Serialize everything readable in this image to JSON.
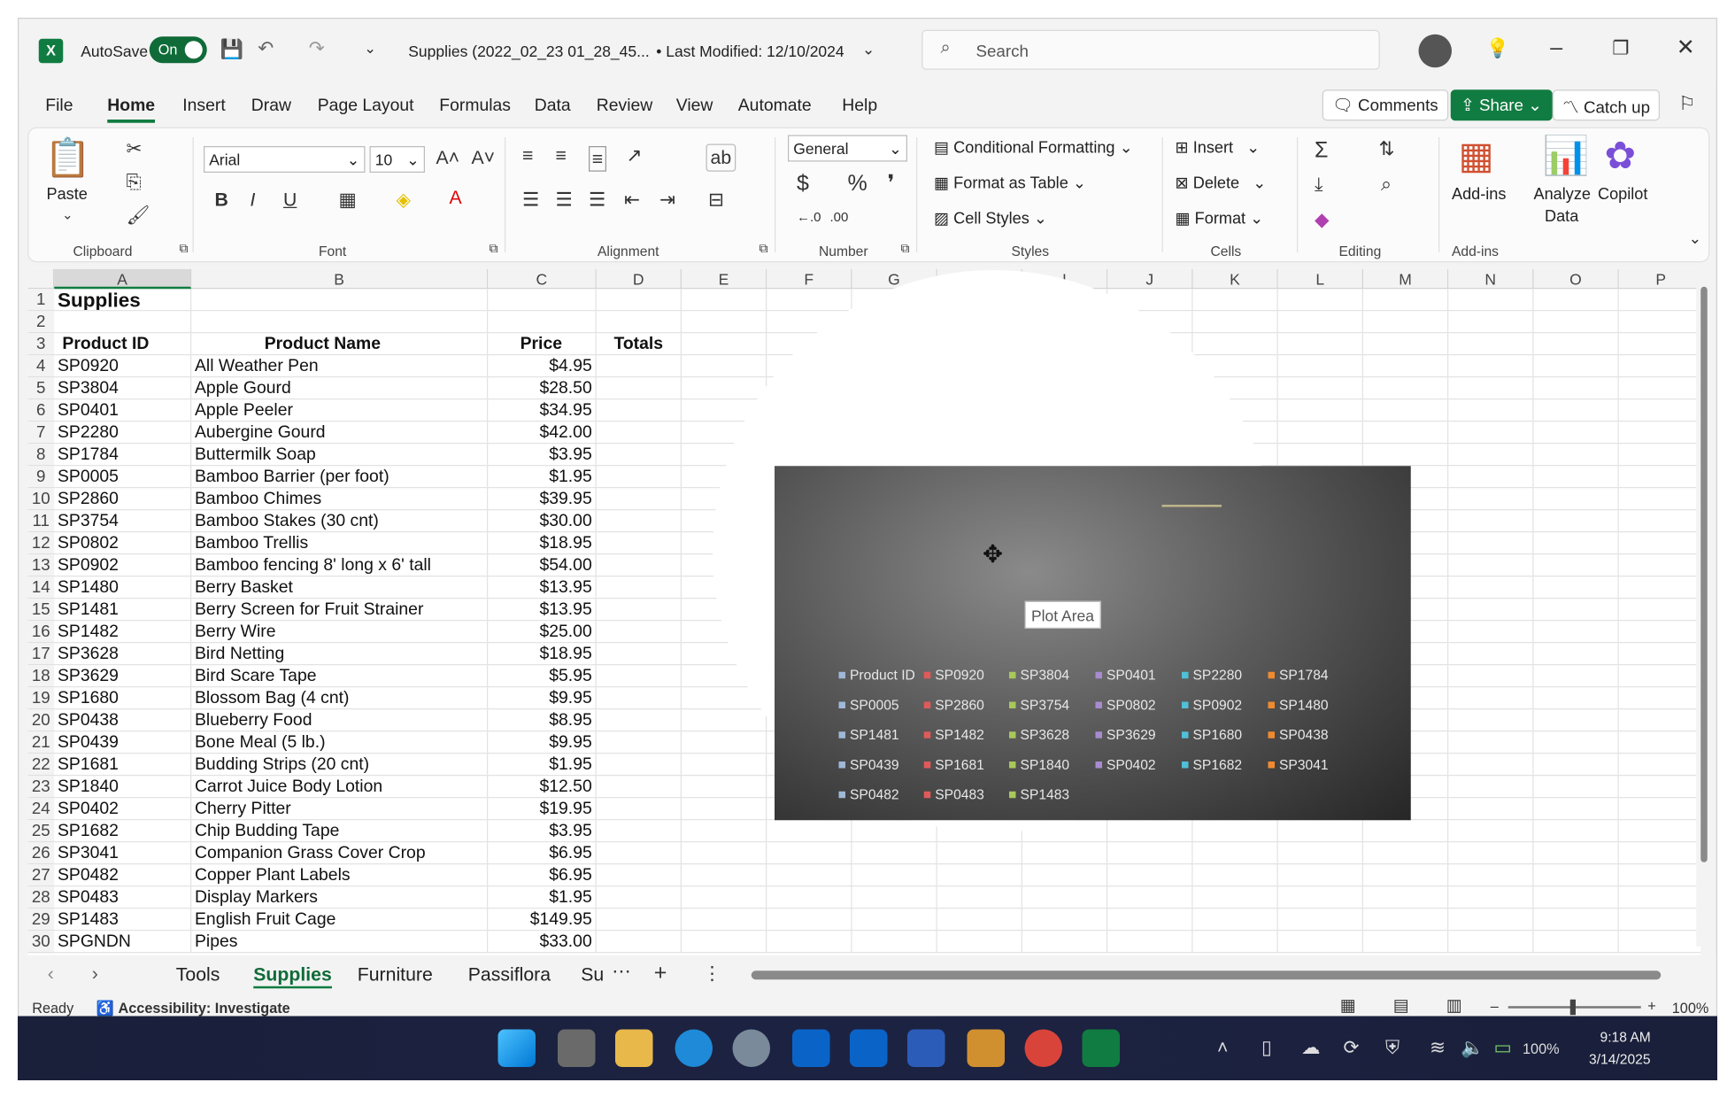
{
  "titlebar": {
    "autosave_label": "AutoSave",
    "autosave_state": "On",
    "filename": "Supplies (2022_02_23 01_28_45...",
    "modified": "• Last Modified: 12/10/2024",
    "search_placeholder": "Search"
  },
  "menu": [
    "File",
    "Home",
    "Insert",
    "Draw",
    "Page Layout",
    "Formulas",
    "Data",
    "Review",
    "View",
    "Automate",
    "Help"
  ],
  "menu_active": "Home",
  "actions": {
    "comments": "Comments",
    "share": "Share",
    "catchup": "Catch up"
  },
  "ribbon": {
    "paste": "Paste",
    "font_name": "Arial",
    "font_size": "10",
    "number_format": "General",
    "conditional_formatting": "Conditional Formatting",
    "format_as_table": "Format as Table",
    "cell_styles": "Cell Styles",
    "insert": "Insert",
    "delete": "Delete",
    "format": "Format",
    "addins": "Add-ins",
    "analyze1": "Analyze",
    "analyze2": "Data",
    "copilot": "Copilot",
    "groups": {
      "clipboard": "Clipboard",
      "font": "Font",
      "alignment": "Alignment",
      "number": "Number",
      "styles": "Styles",
      "cells": "Cells",
      "editing": "Editing",
      "addins": "Add-ins"
    }
  },
  "columns": [
    "A",
    "B",
    "C",
    "D",
    "E",
    "F",
    "G",
    "H",
    "I",
    "J",
    "K",
    "L",
    "M",
    "N",
    "O",
    "P"
  ],
  "sheet": {
    "title": "Supplies",
    "headers": {
      "id": "Product ID",
      "name": "Product Name",
      "price": "Price",
      "totals": "Totals"
    },
    "rows": [
      [
        "SP0920",
        "All Weather Pen",
        "$4.95"
      ],
      [
        "SP3804",
        "Apple Gourd",
        "$28.50"
      ],
      [
        "SP0401",
        "Apple Peeler",
        "$34.95"
      ],
      [
        "SP2280",
        "Aubergine Gourd",
        "$42.00"
      ],
      [
        "SP1784",
        "Buttermilk Soap",
        "$3.95"
      ],
      [
        "SP0005",
        "Bamboo Barrier (per foot)",
        "$1.95"
      ],
      [
        "SP2860",
        "Bamboo Chimes",
        "$39.95"
      ],
      [
        "SP3754",
        "Bamboo Stakes (30 cnt)",
        "$30.00"
      ],
      [
        "SP0802",
        "Bamboo Trellis",
        "$18.95"
      ],
      [
        "SP0902",
        "Bamboo fencing 8' long x 6' tall",
        "$54.00"
      ],
      [
        "SP1480",
        "Berry Basket",
        "$13.95"
      ],
      [
        "SP1481",
        "Berry Screen for Fruit Strainer",
        "$13.95"
      ],
      [
        "SP1482",
        "Berry Wire",
        "$25.00"
      ],
      [
        "SP3628",
        "Bird Netting",
        "$18.95"
      ],
      [
        "SP3629",
        "Bird Scare Tape",
        "$5.95"
      ],
      [
        "SP1680",
        "Blossom Bag (4 cnt)",
        "$9.95"
      ],
      [
        "SP0438",
        "Blueberry Food",
        "$8.95"
      ],
      [
        "SP0439",
        "Bone Meal (5 lb.)",
        "$9.95"
      ],
      [
        "SP1681",
        "Budding Strips (20 cnt)",
        "$1.95"
      ],
      [
        "SP1840",
        "Carrot Juice Body Lotion",
        "$12.50"
      ],
      [
        "SP0402",
        "Cherry Pitter",
        "$19.95"
      ],
      [
        "SP1682",
        "Chip Budding Tape",
        "$3.95"
      ],
      [
        "SP3041",
        "Companion Grass Cover Crop",
        "$6.95"
      ],
      [
        "SP0482",
        "Copper Plant Labels",
        "$6.95"
      ],
      [
        "SP0483",
        "Display Markers",
        "$1.95"
      ],
      [
        "SP1483",
        "English Fruit Cage",
        "$149.95"
      ],
      [
        "SPGNDN",
        "Pipes",
        "$33.00"
      ]
    ]
  },
  "chart": {
    "tooltip": "Plot Area",
    "legend": [
      {
        "label": "Product ID",
        "color": "#9fb8d8"
      },
      {
        "label": "SP0920",
        "color": "#e05a5a"
      },
      {
        "label": "SP3804",
        "color": "#a8c85a"
      },
      {
        "label": "SP0401",
        "color": "#a78bd0"
      },
      {
        "label": "SP2280",
        "color": "#4fc0d8"
      },
      {
        "label": "SP1784",
        "color": "#f08a30"
      },
      {
        "label": "SP0005",
        "color": "#9fb8d8"
      },
      {
        "label": "SP2860",
        "color": "#e05a5a"
      },
      {
        "label": "SP3754",
        "color": "#a8c85a"
      },
      {
        "label": "SP0802",
        "color": "#a78bd0"
      },
      {
        "label": "SP0902",
        "color": "#4fc0d8"
      },
      {
        "label": "SP1480",
        "color": "#f08a30"
      },
      {
        "label": "SP1481",
        "color": "#9fb8d8"
      },
      {
        "label": "SP1482",
        "color": "#e05a5a"
      },
      {
        "label": "SP3628",
        "color": "#a8c85a"
      },
      {
        "label": "SP3629",
        "color": "#a78bd0"
      },
      {
        "label": "SP1680",
        "color": "#4fc0d8"
      },
      {
        "label": "SP0438",
        "color": "#f08a30"
      },
      {
        "label": "SP0439",
        "color": "#9fb8d8"
      },
      {
        "label": "SP1681",
        "color": "#e05a5a"
      },
      {
        "label": "SP1840",
        "color": "#a8c85a"
      },
      {
        "label": "SP0402",
        "color": "#a78bd0"
      },
      {
        "label": "SP1682",
        "color": "#4fc0d8"
      },
      {
        "label": "SP3041",
        "color": "#f08a30"
      },
      {
        "label": "SP0482",
        "color": "#9fb8d8"
      },
      {
        "label": "SP0483",
        "color": "#e05a5a"
      },
      {
        "label": "SP1483",
        "color": "#a8c85a"
      }
    ]
  },
  "tabs": [
    "Tools",
    "Supplies",
    "Furniture",
    "Passiflora",
    "Su"
  ],
  "tab_active": "Supplies",
  "status": {
    "ready": "Ready",
    "accessibility": "Accessibility: Investigate",
    "zoom": "100%"
  },
  "taskbar": {
    "battery": "100%",
    "time": "9:18 AM",
    "date": "3/14/2025"
  },
  "colors": {
    "excel_green": "#107c41",
    "chart_dark": "#2b2b2b"
  }
}
